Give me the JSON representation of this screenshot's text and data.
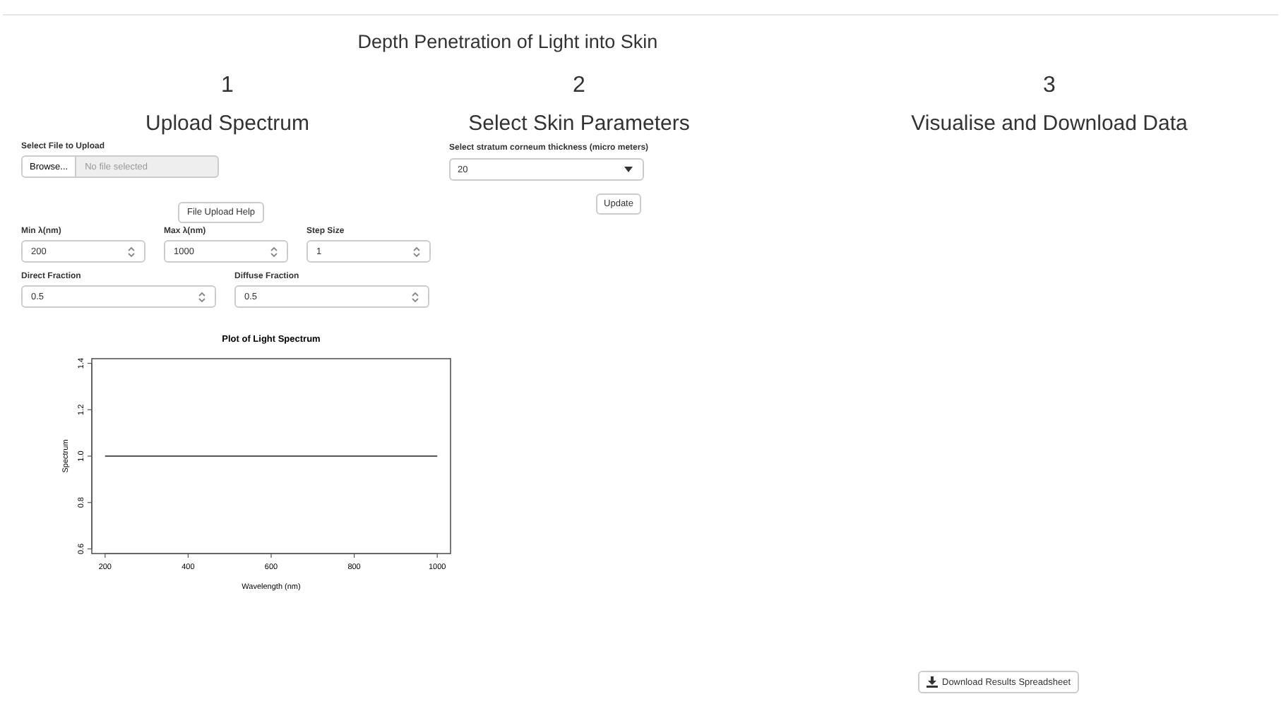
{
  "title": "Depth Penetration of Light into Skin",
  "columns": [
    {
      "number": "1",
      "heading": "Upload Spectrum"
    },
    {
      "number": "2",
      "heading": "Select Skin Parameters"
    },
    {
      "number": "3",
      "heading": "Visualise and Download Data"
    }
  ],
  "upload": {
    "label": "Select File to Upload",
    "browse": "Browse...",
    "placeholder": "No file selected",
    "help_button": "File Upload Help"
  },
  "row1": [
    {
      "label": "Min λ(nm)",
      "value": "200"
    },
    {
      "label": "Max λ(nm)",
      "value": "1000"
    },
    {
      "label": "Step Size",
      "value": "1"
    }
  ],
  "row2": [
    {
      "label": "Direct Fraction",
      "value": "0.5"
    },
    {
      "label": "Diffuse Fraction",
      "value": "0.5"
    }
  ],
  "plot": {
    "chart_data": {
      "type": "line",
      "title": "Plot of Light Spectrum",
      "xlabel": "Wavelength (nm)",
      "ylabel": "Spectrum",
      "x": [
        200,
        1000
      ],
      "series": [
        {
          "color": "#555555",
          "values": [
            1.0,
            1.0
          ]
        }
      ],
      "xlim": [
        168,
        1032
      ],
      "ylim": [
        0.58,
        1.42
      ],
      "xticks": [
        200,
        400,
        600,
        800,
        1000
      ],
      "yticks": [
        0.6,
        0.8,
        {
          "value": 1.0,
          "label": "1.0"
        },
        1.2,
        1.4
      ]
    }
  },
  "skin": {
    "label": "Select stratum corneum thickness (micro meters)",
    "value": "20",
    "update_button": "Update"
  },
  "download_button": "Download Results Spreadsheet"
}
